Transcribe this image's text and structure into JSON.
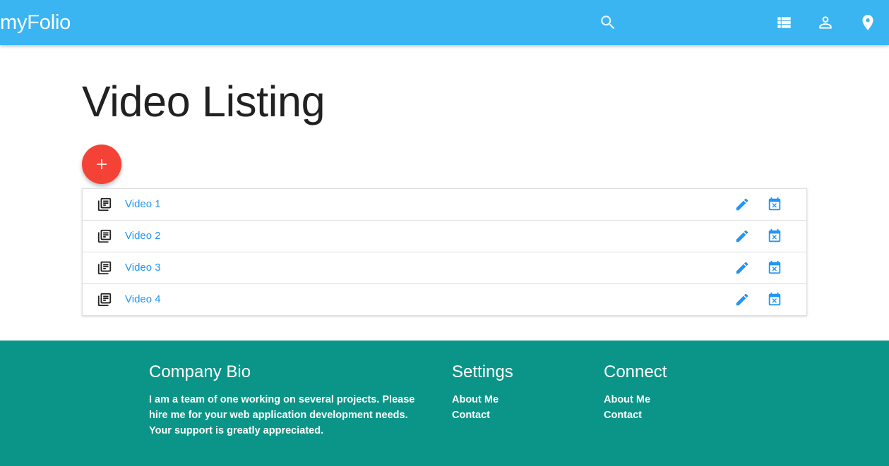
{
  "appbar": {
    "brand": "myFolio",
    "icons": [
      "search-icon",
      "list-icon",
      "person-icon",
      "location-pin-icon"
    ]
  },
  "main": {
    "title": "Video Listing",
    "add_button_icon": "plus-icon",
    "videos": [
      {
        "label": "Video 1"
      },
      {
        "label": "Video 2"
      },
      {
        "label": "Video 3"
      },
      {
        "label": "Video 4"
      }
    ],
    "row_icons": {
      "leading": "library-books-icon",
      "edit": "pencil-icon",
      "delete": "calendar-remove-icon"
    }
  },
  "footer": {
    "bio": {
      "heading": "Company Bio",
      "text": "I am a team of one working on several projects. Please hire me for your web application development needs. Your support is greatly appreciated."
    },
    "settings": {
      "heading": "Settings",
      "links": [
        "About Me",
        "Contact"
      ]
    },
    "connect": {
      "heading": "Connect",
      "links": [
        "About Me",
        "Contact"
      ]
    }
  },
  "colors": {
    "appbar": "#3bb4f2",
    "fab": "#f44336",
    "link": "#2196f3",
    "footer": "#0b9588",
    "title": "#212121"
  }
}
